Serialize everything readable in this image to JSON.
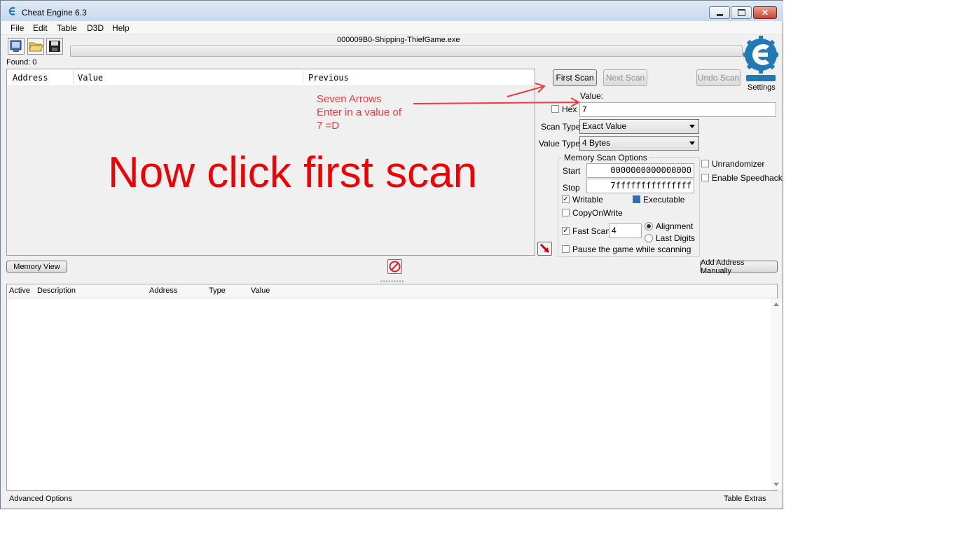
{
  "window": {
    "title": "Cheat Engine 6.3"
  },
  "menu": [
    "File",
    "Edit",
    "Table",
    "D3D",
    "Help"
  ],
  "process": "000009B0-Shipping-ThiefGame.exe",
  "found": "Found: 0",
  "results_columns": [
    "Address",
    "Value",
    "Previous"
  ],
  "annotation": {
    "line1": "Seven Arrows",
    "line2": "Enter in a value of",
    "line3": "7 =D",
    "big": "Now click first scan"
  },
  "scan": {
    "first_scan": "First Scan",
    "next_scan": "Next Scan",
    "undo_scan": "Undo Scan",
    "settings": "Settings",
    "value_label": "Value:",
    "hex_label": "Hex",
    "value": "7",
    "scan_type_label": "Scan Type",
    "scan_type": "Exact Value",
    "value_type_label": "Value Type",
    "value_type": "4 Bytes"
  },
  "memory_scan_options": {
    "title": "Memory Scan Options",
    "start_label": "Start",
    "start": "0000000000000000",
    "stop_label": "Stop",
    "stop": "7fffffffffffffff",
    "writable": "Writable",
    "executable": "Executable",
    "copyonwrite": "CopyOnWrite",
    "fast_scan": "Fast Scan",
    "fast_scan_value": "4",
    "alignment": "Alignment",
    "last_digits": "Last Digits",
    "pause": "Pause the game while scanning"
  },
  "side_options": {
    "unrandomizer": "Unrandomizer",
    "speedhack": "Enable Speedhack"
  },
  "lower": {
    "memory_view": "Memory View",
    "add_address": "Add Address Manually",
    "columns": [
      "Active",
      "Description",
      "Address",
      "Type",
      "Value"
    ],
    "advanced_options": "Advanced Options",
    "table_extras": "Table Extras"
  },
  "colors": {
    "annotation": "#ee3b3b",
    "big_annotation": "#f00000",
    "logo": "#1f7ab5"
  },
  "icons": [
    "cheat-engine-icon",
    "process-select-icon",
    "open-folder-icon",
    "save-disk-icon",
    "cheat-engine-logo",
    "stop-icon",
    "pointer-arrow-icon"
  ]
}
